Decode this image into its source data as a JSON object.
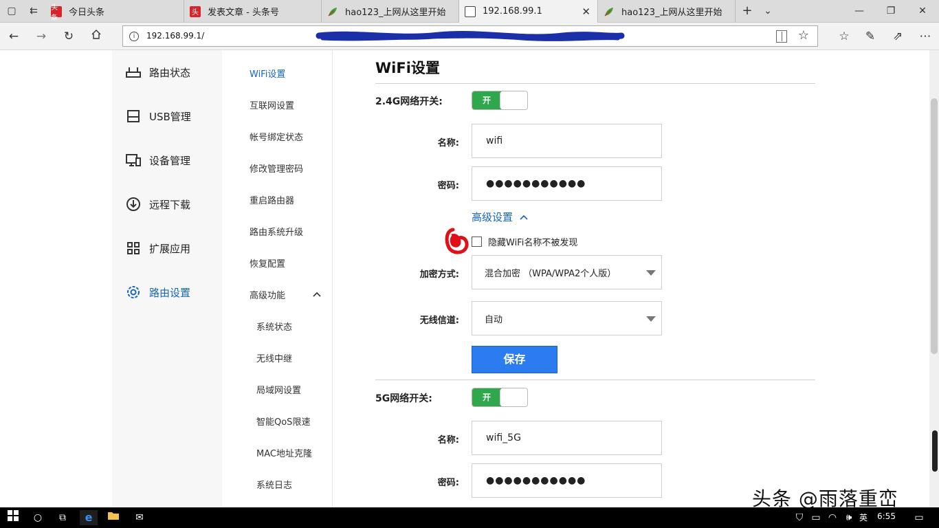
{
  "browser": {
    "tabs": [
      {
        "label": "今日头条",
        "fav": "头条",
        "active": false
      },
      {
        "label": "发表文章 - 头条号",
        "fav": "头",
        "active": false
      },
      {
        "label": "hao123_上网从这里开始",
        "fav": "leaf",
        "active": false
      },
      {
        "label": "192.168.99.1",
        "fav": "page",
        "active": true
      },
      {
        "label": "hao123_上网从这里开始",
        "fav": "leaf",
        "active": false
      }
    ],
    "url": "192.168.99.1/",
    "new_tab": "+",
    "tab_list": "⌄"
  },
  "left_nav": {
    "items": [
      {
        "label": "路由状态",
        "icon": "router-icon"
      },
      {
        "label": "USB管理",
        "icon": "usb-icon"
      },
      {
        "label": "设备管理",
        "icon": "devices-icon"
      },
      {
        "label": "远程下载",
        "icon": "download-icon"
      },
      {
        "label": "扩展应用",
        "icon": "grid-icon"
      },
      {
        "label": "路由设置",
        "icon": "settings-icon",
        "active": true
      }
    ]
  },
  "mid_nav": {
    "items": [
      "WiFi设置",
      "互联网设置",
      "帐号绑定状态",
      "修改管理密码",
      "重启路由器",
      "路由系统升级",
      "恢复配置",
      "高级功能"
    ],
    "sub_items": [
      "系统状态",
      "无线中继",
      "局域网设置",
      "智能QoS限速",
      "MAC地址克隆",
      "系统日志"
    ]
  },
  "content": {
    "title": "WiFi设置",
    "band24": {
      "label": "2.4G网络开关:",
      "toggle": "开",
      "name_label": "名称:",
      "name_value": "wifi",
      "pw_label": "密码:",
      "pw_value": "●●●●●●●●●●●"
    },
    "advanced_link": "高级设置",
    "hide_ssid": "隐藏WiFi名称不被发现",
    "encryption_label": "加密方式:",
    "encryption_value": "混合加密 （WPA/WPA2个人版）",
    "channel_label": "无线信道:",
    "channel_value": "自动",
    "save": "保存",
    "band5": {
      "label": "5G网络开关:",
      "toggle": "开",
      "name_label": "名称:",
      "name_value": "wifi_5G",
      "pw_label": "密码:",
      "pw_value": "●●●●●●●●●●●"
    }
  },
  "taskbar": {
    "lang": "英",
    "time": "6:55"
  },
  "watermark": "头条 @雨落重峦",
  "colors": {
    "accent": "#1565c0",
    "toggle_on": "#2ea84a",
    "save_button": "#2a7cf0",
    "scribble": "#1a2fa8",
    "red_mark": "#e0101a"
  }
}
